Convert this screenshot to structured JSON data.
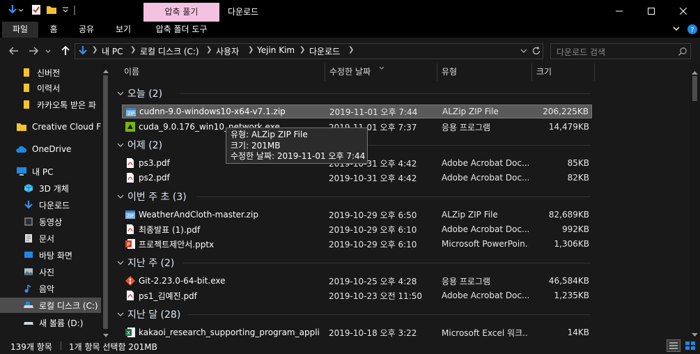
{
  "window": {
    "title": "다운로드",
    "context_tab": "압축 풀기",
    "context_subtab": "압축 폴더 도구"
  },
  "ribbon": {
    "tabs": [
      "파일",
      "홈",
      "공유",
      "보기"
    ]
  },
  "address": {
    "crumbs": [
      "내 PC",
      "로컬 디스크 (C:)",
      "사용자",
      "Yejin Kim",
      "다운로드"
    ],
    "search_placeholder": "다운로드 검색"
  },
  "sidebar": {
    "items": [
      {
        "label": "신버전",
        "icon": "folder-icon"
      },
      {
        "label": "이력서",
        "icon": "folder-icon"
      },
      {
        "label": "카카오톡 받은 파",
        "icon": "folder-icon"
      },
      {
        "label": "Creative Cloud Fil",
        "icon": "cloud-folder-icon"
      },
      {
        "label": "OneDrive",
        "icon": "onedrive-icon"
      },
      {
        "label": "내 PC",
        "icon": "pc-icon"
      },
      {
        "label": "3D 개체",
        "icon": "cube-icon"
      },
      {
        "label": "다운로드",
        "icon": "download-icon"
      },
      {
        "label": "동영상",
        "icon": "video-icon"
      },
      {
        "label": "문서",
        "icon": "document-icon"
      },
      {
        "label": "바탕 화면",
        "icon": "desktop-icon"
      },
      {
        "label": "사진",
        "icon": "picture-icon"
      },
      {
        "label": "음악",
        "icon": "music-icon"
      },
      {
        "label": "로컬 디스크 (C:)",
        "icon": "disk-icon"
      },
      {
        "label": "새 볼륨 (D:)",
        "icon": "disk-icon"
      }
    ],
    "selected_index": 13
  },
  "columns": {
    "name": "이름",
    "date": "수정한 날짜",
    "type": "유형",
    "size": "크기"
  },
  "groups": [
    {
      "label": "오늘 (2)",
      "files": [
        {
          "name": "cudnn-9.0-windows10-x64-v7.1.zip",
          "date": "2019-11-01 오후 7:44",
          "type": "ALZip ZIP File",
          "size": "206,225KB",
          "icon": "zip-icon",
          "selected": true
        },
        {
          "name": "cuda_9.0.176_win10_network.exe",
          "date": "2019-11-01 오후 7:37",
          "type": "응용 프로그램",
          "size": "14,479KB",
          "icon": "exe-icon",
          "selected": false
        }
      ]
    },
    {
      "label": "어제 (2)",
      "files": [
        {
          "name": "ps3.pdf",
          "date": "2019-10-31 오후 4:42",
          "type": "Adobe Acrobat Doc...",
          "size": "85KB",
          "icon": "pdf-icon",
          "selected": false
        },
        {
          "name": "ps2.pdf",
          "date": "2019-10-31 오후 4:42",
          "type": "Adobe Acrobat Doc...",
          "size": "82KB",
          "icon": "pdf-icon",
          "selected": false
        }
      ]
    },
    {
      "label": "이번 주 초 (3)",
      "files": [
        {
          "name": "WeatherAndCloth-master.zip",
          "date": "2019-10-29 오후 6:50",
          "type": "ALZip ZIP File",
          "size": "82,689KB",
          "icon": "zip-icon",
          "selected": false
        },
        {
          "name": "최종발표 (1).pdf",
          "date": "2019-10-29 오후 6:10",
          "type": "Adobe Acrobat Doc...",
          "size": "992KB",
          "icon": "pdf-icon",
          "selected": false
        },
        {
          "name": "프로젝트제안서.pptx",
          "date": "2019-10-29 오후 6:10",
          "type": "Microsoft PowerPoin...",
          "size": "1,306KB",
          "icon": "pptx-icon",
          "selected": false
        }
      ]
    },
    {
      "label": "지난 주 (2)",
      "files": [
        {
          "name": "Git-2.23.0-64-bit.exe",
          "date": "2019-10-25 오후 4:28",
          "type": "응용 프로그램",
          "size": "46,584KB",
          "icon": "git-icon",
          "selected": false
        },
        {
          "name": "ps1_김예진.pdf",
          "date": "2019-10-23 오전 11:50",
          "type": "Adobe Acrobat Doc...",
          "size": "1,235KB",
          "icon": "pdf-icon",
          "selected": false
        }
      ]
    },
    {
      "label": "지난 달 (28)",
      "files": [
        {
          "name": "kakaoi_research_supporting_program_applicati...",
          "date": "2019-10-18 오후 3:22",
          "type": "Microsoft Excel 워크...",
          "size": "14KB",
          "icon": "excel-icon",
          "selected": false
        }
      ]
    }
  ],
  "tooltip": {
    "lines": [
      "유형: ALZip ZIP File",
      "크기: 201MB",
      "수정한 날짜: 2019-11-01 오후 7:44"
    ]
  },
  "status": {
    "count": "139개 항목",
    "selection": "1개 항목 선택함 201MB"
  },
  "colors": {
    "background": "#191919",
    "titlebar": "#000000",
    "context_tab": "#f5c1e1",
    "selection": "#5a5a5a",
    "sidebar_selection": "#4d4d4d"
  }
}
